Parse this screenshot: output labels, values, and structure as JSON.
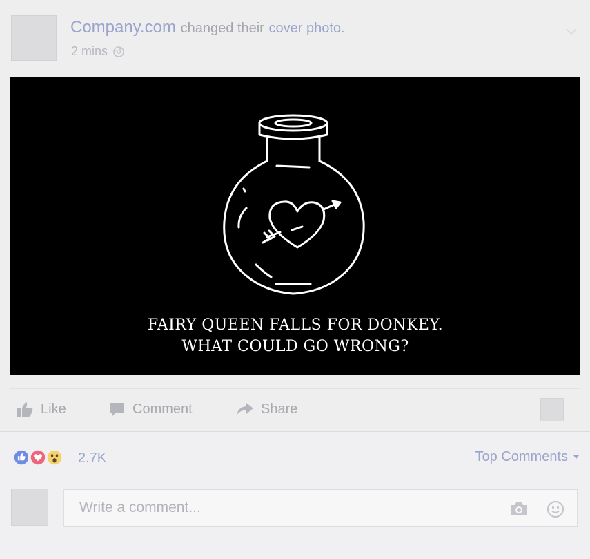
{
  "post": {
    "page_name": "Company.com",
    "action_text": "changed their",
    "action_link": "cover photo.",
    "timestamp": "2 mins"
  },
  "cover": {
    "caption_line1": "FAIRY QUEEN FALLS FOR DONKEY.",
    "caption_line2": "WHAT COULD GO WRONG?"
  },
  "actions": {
    "like_label": "Like",
    "comment_label": "Comment",
    "share_label": "Share"
  },
  "reactions": {
    "icons": [
      "like-icon",
      "love-icon",
      "wow-icon"
    ],
    "count": "2.7K"
  },
  "comments": {
    "sort_label": "Top Comments",
    "placeholder": "Write a comment..."
  },
  "colors": {
    "link": "#9aa5cc",
    "like": "#6f8de0",
    "love": "#f0657a",
    "wow": "#f5d36a"
  }
}
